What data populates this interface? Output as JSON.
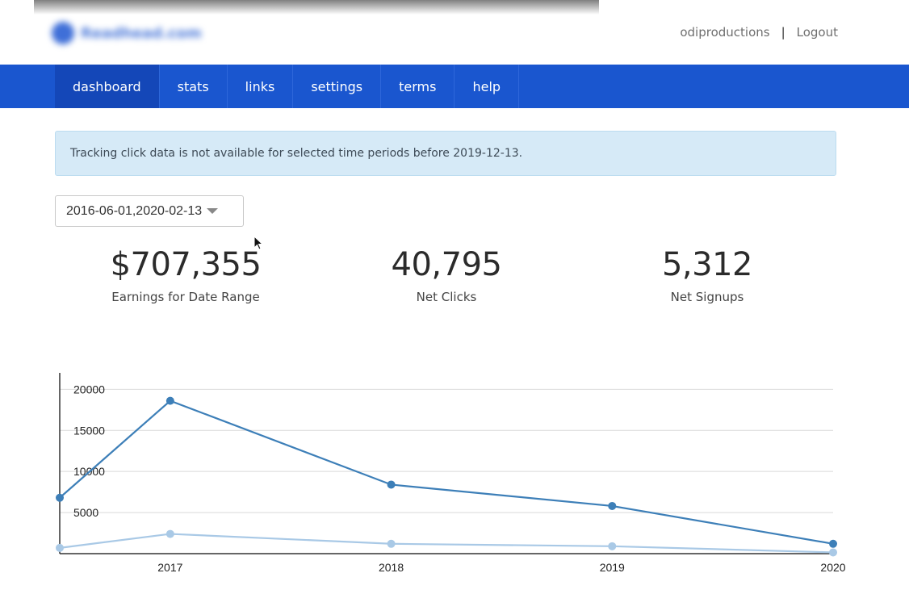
{
  "header": {
    "logo_text": "Readhead.com",
    "username": "odiproductions",
    "separator": "|",
    "logout": "Logout"
  },
  "nav": {
    "items": [
      "dashboard",
      "stats",
      "links",
      "settings",
      "terms",
      "help"
    ],
    "active": "dashboard"
  },
  "alert": {
    "text": "Tracking click data is not available for selected time periods before 2019-12-13."
  },
  "date_range": {
    "value": "2016-06-01,2020-02-13"
  },
  "stats": [
    {
      "value": "$707,355",
      "label": "Earnings for Date Range"
    },
    {
      "value": "40,795",
      "label": "Net Clicks"
    },
    {
      "value": "5,312",
      "label": "Net Signups"
    }
  ],
  "colors": {
    "nav_bg": "#1a56cf",
    "series_dark": "#3d7fb8",
    "series_light": "#a9c9e6"
  },
  "chart_data": {
    "type": "line",
    "x": [
      2016.5,
      2017,
      2018,
      2019,
      2020
    ],
    "xticks": [
      "2017",
      "2018",
      "2019",
      "2020"
    ],
    "yticks": [
      5000,
      10000,
      15000,
      20000
    ],
    "ylim": [
      0,
      22000
    ],
    "grid": true,
    "series": [
      {
        "values": [
          6800,
          18600,
          8400,
          5800,
          1200
        ],
        "color": "#3d7fb8"
      },
      {
        "values": [
          700,
          2400,
          1200,
          900,
          150
        ],
        "color": "#a9c9e6"
      }
    ]
  }
}
